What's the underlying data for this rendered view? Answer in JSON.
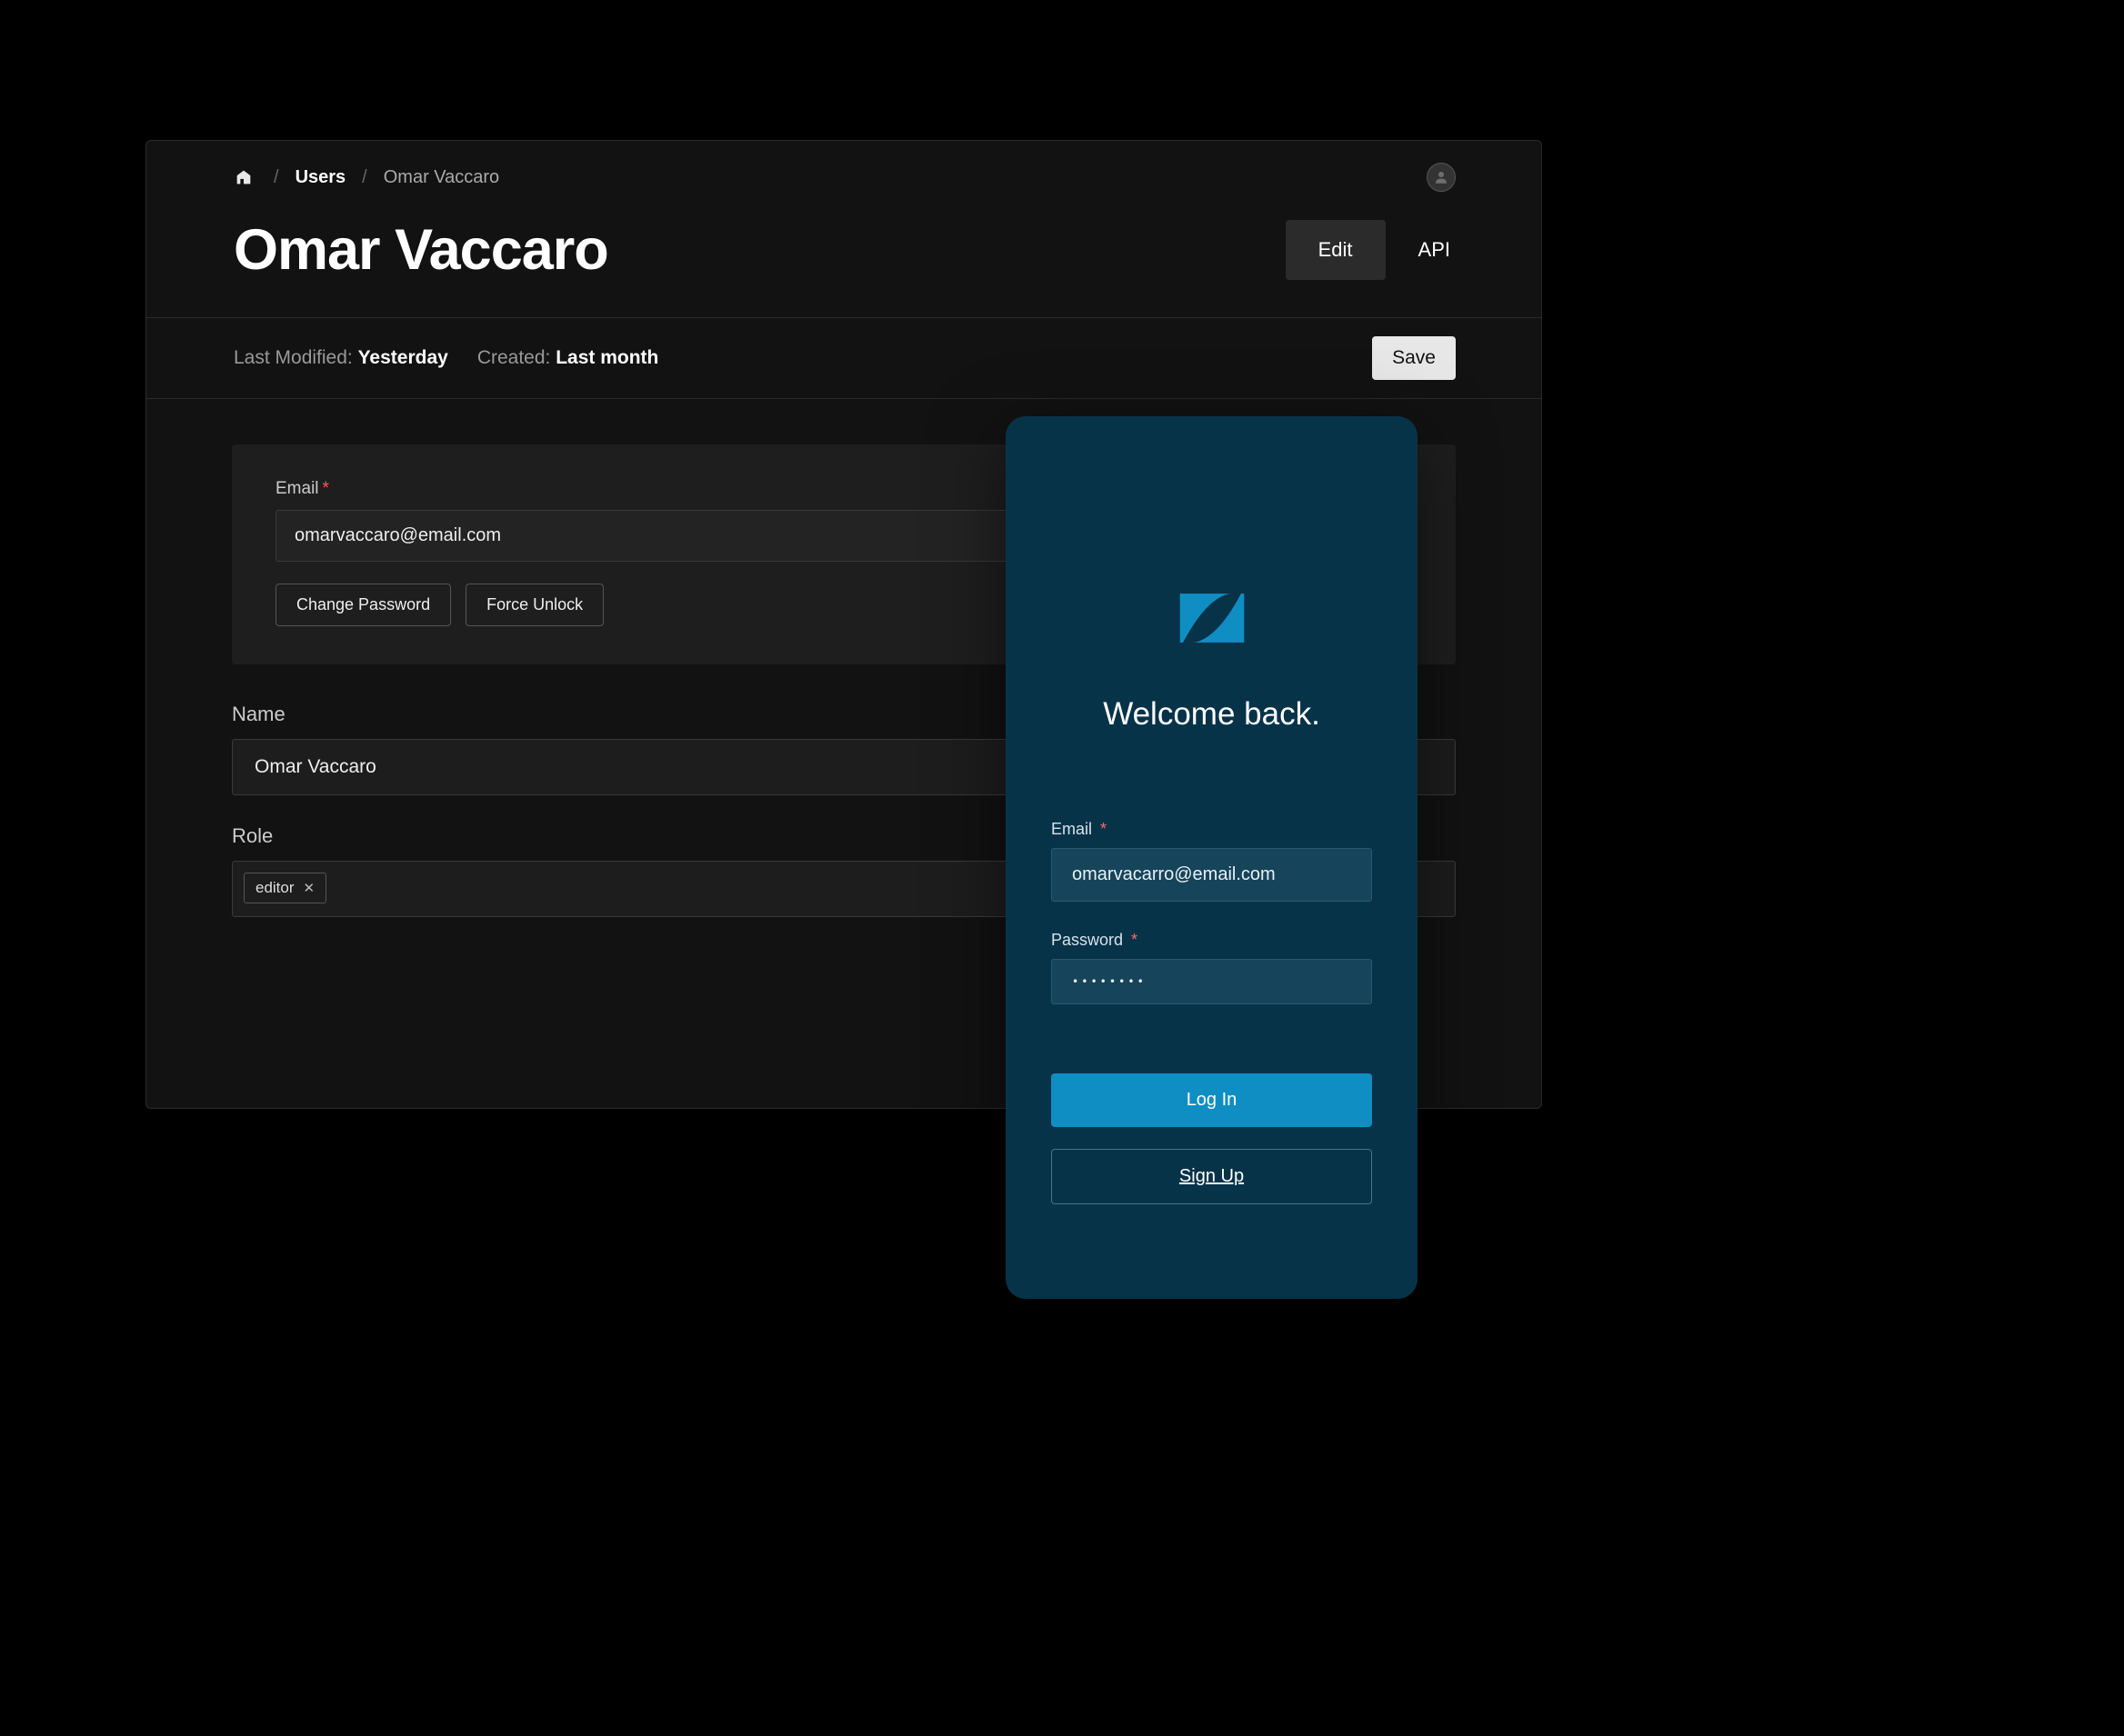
{
  "admin": {
    "breadcrumb": {
      "users": "Users",
      "current": "Omar Vaccaro"
    },
    "title": "Omar Vaccaro",
    "tabs": {
      "edit": "Edit",
      "api": "API"
    },
    "meta": {
      "last_modified_label": "Last Modified: ",
      "last_modified_value": "Yesterday",
      "created_label": "Created: ",
      "created_value": "Last month",
      "save": "Save"
    },
    "fields": {
      "email_label": "Email",
      "email_value": "omarvaccaro@email.com",
      "change_password": "Change Password",
      "force_unlock": "Force Unlock",
      "name_label": "Name",
      "name_value": "Omar Vaccaro",
      "role_label": "Role",
      "role_chip": "editor"
    }
  },
  "login": {
    "welcome": "Welcome back.",
    "email_label": "Email",
    "email_value": "omarvacarro@email.com",
    "password_label": "Password",
    "password_value": "••••••••",
    "login_btn": "Log In",
    "signup_btn": "Sign Up"
  },
  "colors": {
    "admin_bg": "#121212",
    "login_bg": "#073349",
    "accent_blue": "#0f8ec4"
  }
}
